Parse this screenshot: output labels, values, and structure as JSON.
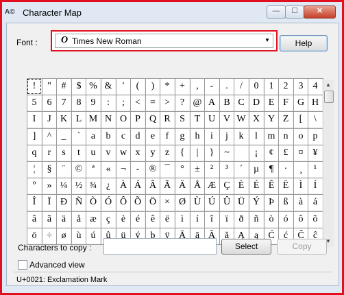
{
  "window": {
    "title": "Character Map",
    "app_icon": "character-map-icon",
    "controls": {
      "minimize": "—",
      "maximize": "☐",
      "close": "✕"
    }
  },
  "font": {
    "label": "Font :",
    "value": "Times New Roman",
    "icon_glyph": "O",
    "icon": "opentype-font-icon"
  },
  "help_label": "Help",
  "grid": {
    "cells": [
      "!",
      "\"",
      "#",
      "$",
      "%",
      "&",
      "'",
      "(",
      ")",
      "*",
      "+",
      ",",
      "-",
      ".",
      "/",
      "0",
      "1",
      "2",
      "3",
      "4",
      "5",
      "6",
      "7",
      "8",
      "9",
      ":",
      ";",
      "<",
      "=",
      ">",
      "?",
      "@",
      "A",
      "B",
      "C",
      "D",
      "E",
      "F",
      "G",
      "H",
      "I",
      "J",
      "K",
      "L",
      "M",
      "N",
      "O",
      "P",
      "Q",
      "R",
      "S",
      "T",
      "U",
      "V",
      "W",
      "X",
      "Y",
      "Z",
      "[",
      "\\",
      "]",
      "^",
      "_",
      "`",
      "a",
      "b",
      "c",
      "d",
      "e",
      "f",
      "g",
      "h",
      "i",
      "j",
      "k",
      "l",
      "m",
      "n",
      "o",
      "p",
      "q",
      "r",
      "s",
      "t",
      "u",
      "v",
      "w",
      "x",
      "y",
      "z",
      "{",
      "|",
      "}",
      "~",
      " ",
      "¡",
      "¢",
      "£",
      "¤",
      "¥",
      "¦",
      "§",
      "¨",
      "©",
      "ª",
      "«",
      "¬",
      "-",
      "®",
      "¯",
      "°",
      "±",
      "²",
      "³",
      "´",
      "µ",
      "¶",
      "·",
      "¸",
      "¹",
      "º",
      "»",
      "¼",
      "½",
      "¾",
      "¿",
      "À",
      "Á",
      "Â",
      "Ã",
      "Ä",
      "Å",
      "Æ",
      "Ç",
      "È",
      "É",
      "Ê",
      "Ë",
      "Ì",
      "Í",
      "Î",
      "Ï",
      "Ð",
      "Ñ",
      "Ò",
      "Ó",
      "Ô",
      "Õ",
      "Ö",
      "×",
      "Ø",
      "Ù",
      "Ú",
      "Û",
      "Ü",
      "Ý",
      "Þ",
      "ß",
      "à",
      "á",
      "â",
      "ã",
      "ä",
      "å",
      "æ",
      "ç",
      "è",
      "é",
      "ê",
      "ë",
      "ì",
      "í",
      "î",
      "ï",
      "ð",
      "ñ",
      "ò",
      "ó",
      "ô",
      "õ",
      "ö",
      "÷",
      "ø",
      "ù",
      "ú",
      "û",
      "ü",
      "ý",
      "þ",
      "ÿ",
      "Ā",
      "ā",
      "Ă",
      "ă",
      "Ą",
      "ą",
      "Ć",
      "ć",
      "Ĉ",
      "ĉ"
    ],
    "selected_index": 0
  },
  "copy": {
    "label": "Characters to copy :",
    "value": "",
    "select_label": "Select",
    "copy_label": "Copy"
  },
  "advanced": {
    "label": "Advanced view",
    "checked": false
  },
  "status": {
    "text": "U+0021: Exclamation Mark"
  },
  "scrollbar": {
    "up": "▲",
    "down": "▼"
  }
}
